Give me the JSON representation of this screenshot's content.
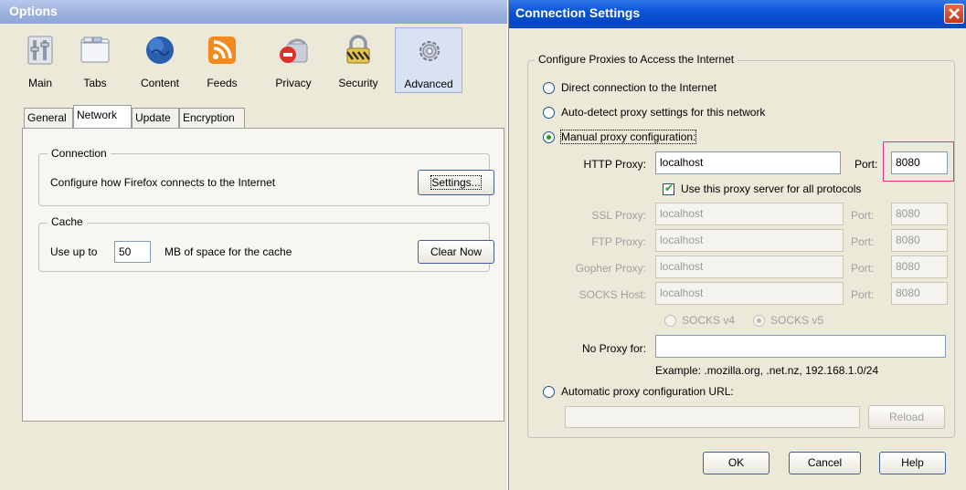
{
  "options": {
    "title": "Options",
    "categories": [
      {
        "label": "Main",
        "icon": "main-switch-icon"
      },
      {
        "label": "Tabs",
        "icon": "tabs-window-icon"
      },
      {
        "label": "Content",
        "icon": "globe-icon"
      },
      {
        "label": "Feeds",
        "icon": "rss-feed-icon"
      },
      {
        "label": "Privacy",
        "icon": "privacy-mask-icon"
      },
      {
        "label": "Security",
        "icon": "padlock-icon"
      },
      {
        "label": "Advanced",
        "icon": "gear-icon"
      }
    ],
    "selected_category": "Advanced",
    "tabs": [
      "General",
      "Network",
      "Update",
      "Encryption"
    ],
    "selected_tab": "Network",
    "connection": {
      "group_label": "Connection",
      "description": "Configure how Firefox connects to the Internet",
      "settings_button": "Settings..."
    },
    "cache": {
      "group_label": "Cache",
      "use_up_to": "Use up to",
      "value": "50",
      "unit": "MB of space for the cache",
      "clear_button": "Clear Now"
    }
  },
  "connection_settings": {
    "title": "Connection Settings",
    "group_label": "Configure Proxies to Access the Internet",
    "direct": "Direct connection to the Internet",
    "autodetect": "Auto-detect proxy settings for this network",
    "manual": "Manual proxy configuration:",
    "selected_option": "manual",
    "http_label": "HTTP Proxy:",
    "http_value": "localhost",
    "port_label": "Port:",
    "http_port": "8080",
    "use_same": "Use this proxy server for all protocols",
    "use_same_checked": true,
    "ssl_label": "SSL Proxy:",
    "ssl_value": "localhost",
    "ssl_port": "8080",
    "ftp_label": "FTP Proxy:",
    "ftp_value": "localhost",
    "ftp_port": "8080",
    "gopher_label": "Gopher Proxy:",
    "gopher_value": "localhost",
    "gopher_port": "8080",
    "socks_label": "SOCKS Host:",
    "socks_value": "localhost",
    "socks_port": "8080",
    "socks_v4": "SOCKS v4",
    "socks_v5": "SOCKS v5",
    "no_proxy_label": "No Proxy for:",
    "no_proxy_value": "",
    "example": "Example: .mozilla.org, .net.nz, 192.168.1.0/24",
    "auto_url": "Automatic proxy configuration URL:",
    "auto_url_value": "",
    "reload_button": "Reload",
    "ok_button": "OK",
    "cancel_button": "Cancel",
    "help_button": "Help",
    "highlight_color": "#e8308a"
  }
}
